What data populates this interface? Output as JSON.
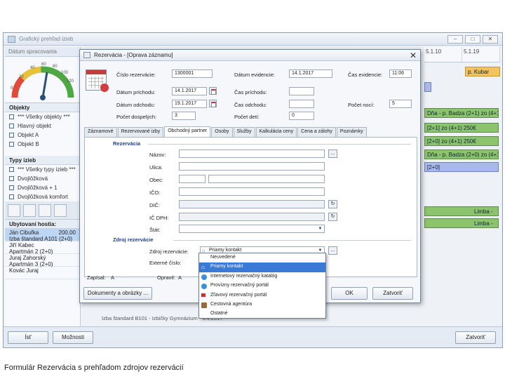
{
  "app": {
    "title": "Grafický prehľad izieb",
    "left_header": "Dátum spracovania",
    "gauge_ticks": [
      "20",
      "40",
      "60",
      "80",
      "100",
      "120",
      "0"
    ],
    "objects_header": "Objekty",
    "objects": [
      "*** Všetky objekty ***",
      "Hlavný objekt",
      "Objekt A",
      "Objekt B"
    ],
    "room_types_header": "Typy izieb",
    "room_types": [
      "*** Všetky typy izieb ***",
      "Dvojlôžková",
      "Dvojlôžková + 1",
      "Dvojlôžková komfort"
    ],
    "guests_header": "Ubytovaní hostia:",
    "guests": [
      {
        "name": "Ján Cibuľka",
        "amount": "200,00",
        "room": "Izba štandard A101 (2+0)"
      },
      {
        "name": "Jiří Kabec",
        "amount": "",
        "room": "Apartmán 2 (2+0)"
      },
      {
        "name": "Juraj Zahorský",
        "amount": "",
        "room": "Apartmán 3 (2+0)"
      },
      {
        "name": "Kovác Juraj",
        "amount": "",
        "room": ""
      }
    ],
    "grid_days": [
      "5.1.10",
      "5.1.19"
    ],
    "bars": [
      {
        "text": "Dňa - p. Badza (2+1) zo (4+1)",
        "color": "green"
      },
      {
        "text": "[2+1] zo (4+1) 250€",
        "color": "green"
      },
      {
        "text": "[2+0] zo (4+1) 250€",
        "color": "green"
      },
      {
        "text": "Dňa - p. Badza (2+0) zo (4+1)",
        "color": "green"
      },
      {
        "text": "[2+0]",
        "color": "blue"
      },
      {
        "text": "Limba -",
        "color": "green"
      },
      {
        "text": "Limba -",
        "color": "green"
      },
      {
        "text": "p. Kubar",
        "color": "orange"
      }
    ],
    "bottom_row_text": "Izba štandard B101 - Izbičky Gymnázium - 4.4.2017",
    "buttons": {
      "left": "Ísť",
      "left2": "Možnosti",
      "right": "Zatvoriť"
    }
  },
  "dialog": {
    "title": "Rezervácia - [Oprava záznamu]",
    "fields": {
      "reservation_no_label": "Číslo rezervácie:",
      "reservation_no": "1300001",
      "record_date_label": "Dátum evidencie:",
      "record_date": "14.1.2017",
      "record_time_label": "Čas evidencie:",
      "record_time": "11:06",
      "arrival_date_label": "Dátum príchodu:",
      "arrival_date": "14.1.2017",
      "arrival_time_label": "Čas príchodu:",
      "arrival_time": "",
      "departure_date_label": "Dátum odchodu:",
      "departure_date": "19.1.2017",
      "departure_time_label": "Čas odchodu:",
      "departure_time": "",
      "nights_label": "Počet nocí:",
      "nights": "5",
      "adults_label": "Počet dospelých:",
      "adults": "3",
      "children_label": "Počet detí:",
      "children": "0"
    },
    "tabs": [
      "Záznamové",
      "Rezervované izby",
      "Obchodný partner",
      "Osoby",
      "Služby",
      "Kalkulácia ceny",
      "Cena a zálohy",
      "Poznámky"
    ],
    "active_tab": 2,
    "group_reservation": "Rezervácia",
    "partner_labels": [
      "Názov:",
      "Ulica:",
      "Obec:",
      "IČO:",
      "DIČ:",
      "IČ DPH:",
      "Štát:"
    ],
    "group_source": "Zdroj rezervácie",
    "source_label": "Zdroj rezervácie:",
    "source_value": "Priamy kontakt",
    "external_no_label": "Externé číslo:",
    "recorded_by_label": "Zapísal:",
    "recorded_by": "A",
    "edited_by_label": "Opravil:",
    "edited_by": "A",
    "docs_button": "Dokumenty a obrázky ...",
    "ok_button": "OK",
    "close_button": "Zatvoriť",
    "source_options": [
      {
        "label": "Neuvedené",
        "icon": "blank-icon"
      },
      {
        "label": "Priamy kontakt",
        "icon": "house-icon",
        "selected": true
      },
      {
        "label": "Internetový rezervačný katalóg",
        "icon": "globe-icon"
      },
      {
        "label": "Provízny rezervačný portál",
        "icon": "globe-icon"
      },
      {
        "label": "Zľavový rezervačný portál",
        "icon": "flag-icon"
      },
      {
        "label": "Cestovná agentúra",
        "icon": "suitcase-icon"
      },
      {
        "label": "Ostatné",
        "icon": "blank-icon"
      }
    ]
  },
  "caption": "Formulár Rezervácia s prehľadom zdrojov rezervácií",
  "colors": {
    "selection": "#3b79d6",
    "bar_green": "#8bc46c",
    "group_blue": "#1b3f91"
  }
}
